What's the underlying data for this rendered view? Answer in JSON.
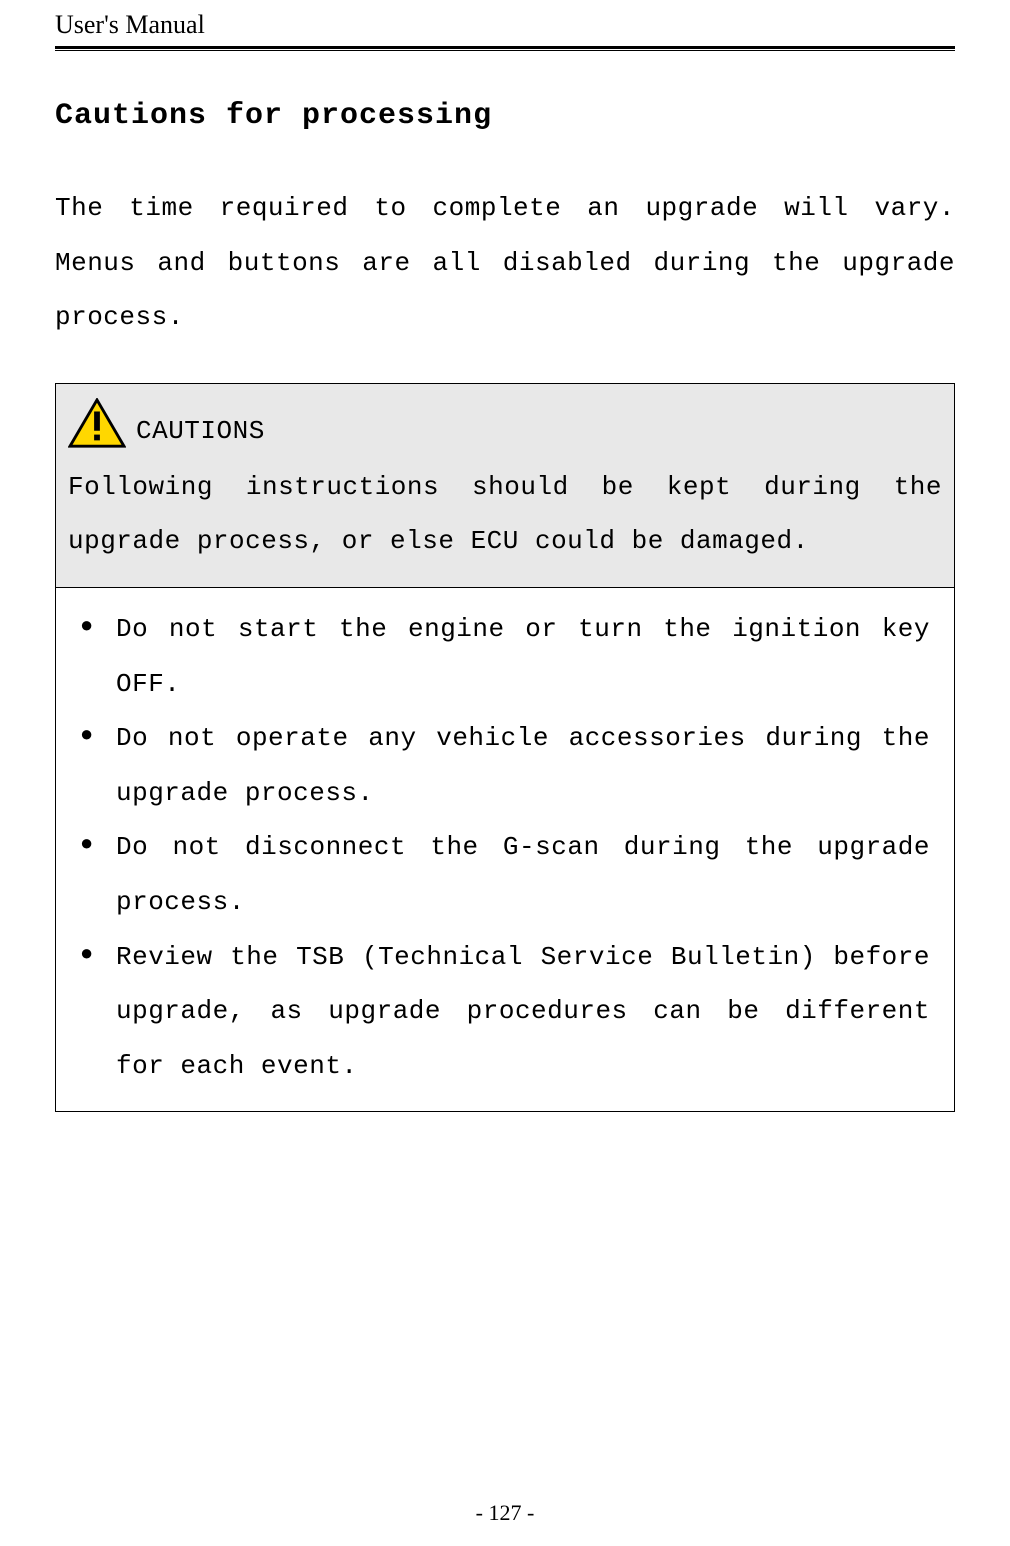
{
  "header": {
    "title": "User's Manual"
  },
  "section": {
    "title": "Cautions for processing",
    "intro": "The time required to complete an upgrade will vary. Menus and buttons are all disabled during the upgrade process."
  },
  "caution_box": {
    "label": "CAUTIONS",
    "instruction": "Following instructions should be kept during the upgrade process, or else ECU could be damaged.",
    "bullets": [
      "Do not start the engine or turn the ignition key OFF.",
      "Do not operate any vehicle accessories during the upgrade process.",
      "Do not disconnect the G-scan during the upgrade process.",
      "Review the TSB (Technical Service Bulletin) before upgrade, as upgrade procedures can be different for each event."
    ]
  },
  "footer": {
    "page_number": "- 127 -"
  }
}
